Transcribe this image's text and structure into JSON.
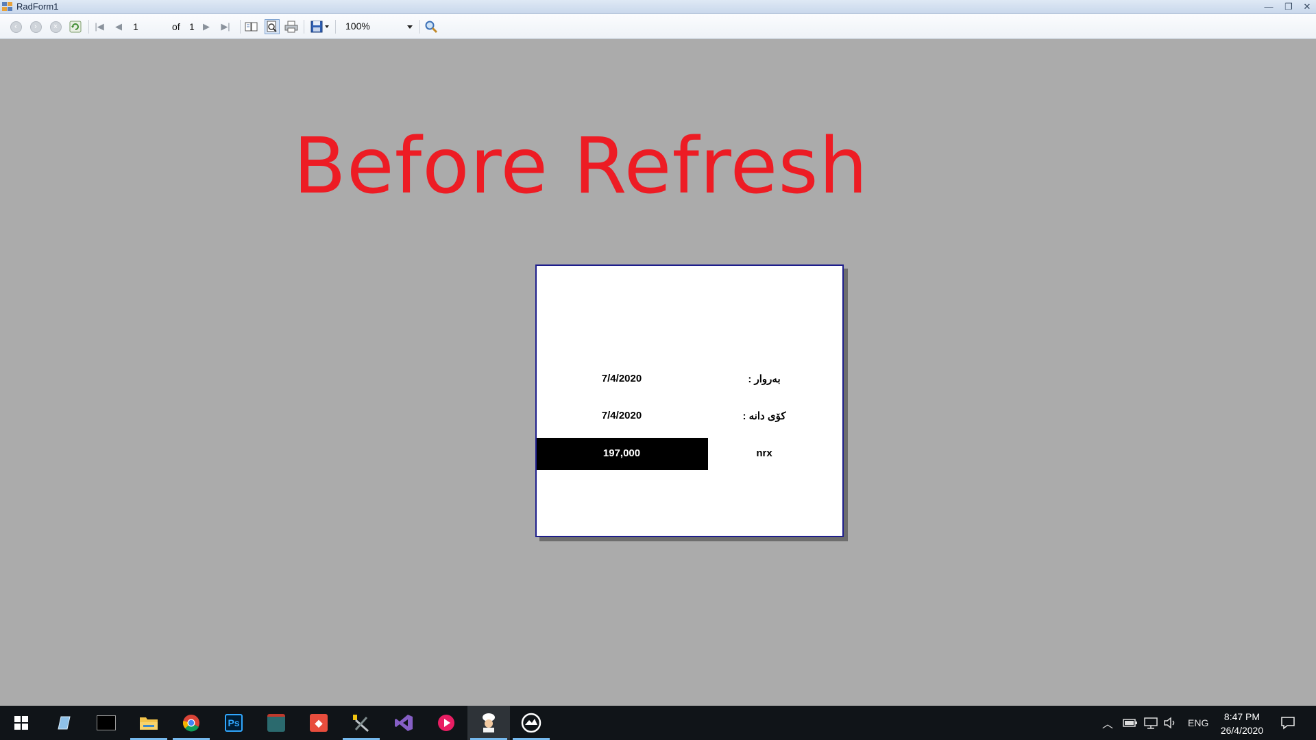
{
  "window": {
    "title": "RadForm1",
    "minimize_glyph": "—",
    "restore_glyph": "❐",
    "close_glyph": "✕"
  },
  "toolbar": {
    "icons": [
      "back-icon",
      "forward-icon",
      "stop-icon",
      "refresh-icon",
      "first-page-icon",
      "previous-page-icon",
      "next-page-icon",
      "last-page-icon",
      "document-map-icon",
      "print-preview-icon",
      "print-icon",
      "export-icon",
      "search-icon"
    ],
    "current_page": "1",
    "of_label": "of",
    "total_pages": "1",
    "zoom": "100%"
  },
  "overlay": {
    "headline": "Before Refresh",
    "color": "#ed1c24"
  },
  "report": {
    "rows": [
      {
        "value": "7/4/2020",
        "label": "بەروار :"
      },
      {
        "value": "7/4/2020",
        "label": "كۆی دانە :"
      },
      {
        "value": "197,000",
        "label": "nrx"
      }
    ]
  },
  "taskbar": {
    "apps": [
      "start-icon",
      "edit-icon",
      "terminal-icon",
      "file-explorer-icon",
      "chrome-icon",
      "photoshop-icon",
      "database-icon",
      "git-icon",
      "tools-icon",
      "visual-studio-icon",
      "media-player-icon",
      "chef-icon",
      "speedometer-icon"
    ],
    "photoshop_text": "Ps",
    "language": "ENG",
    "time": "8:47 PM",
    "date": "26/4/2020"
  }
}
